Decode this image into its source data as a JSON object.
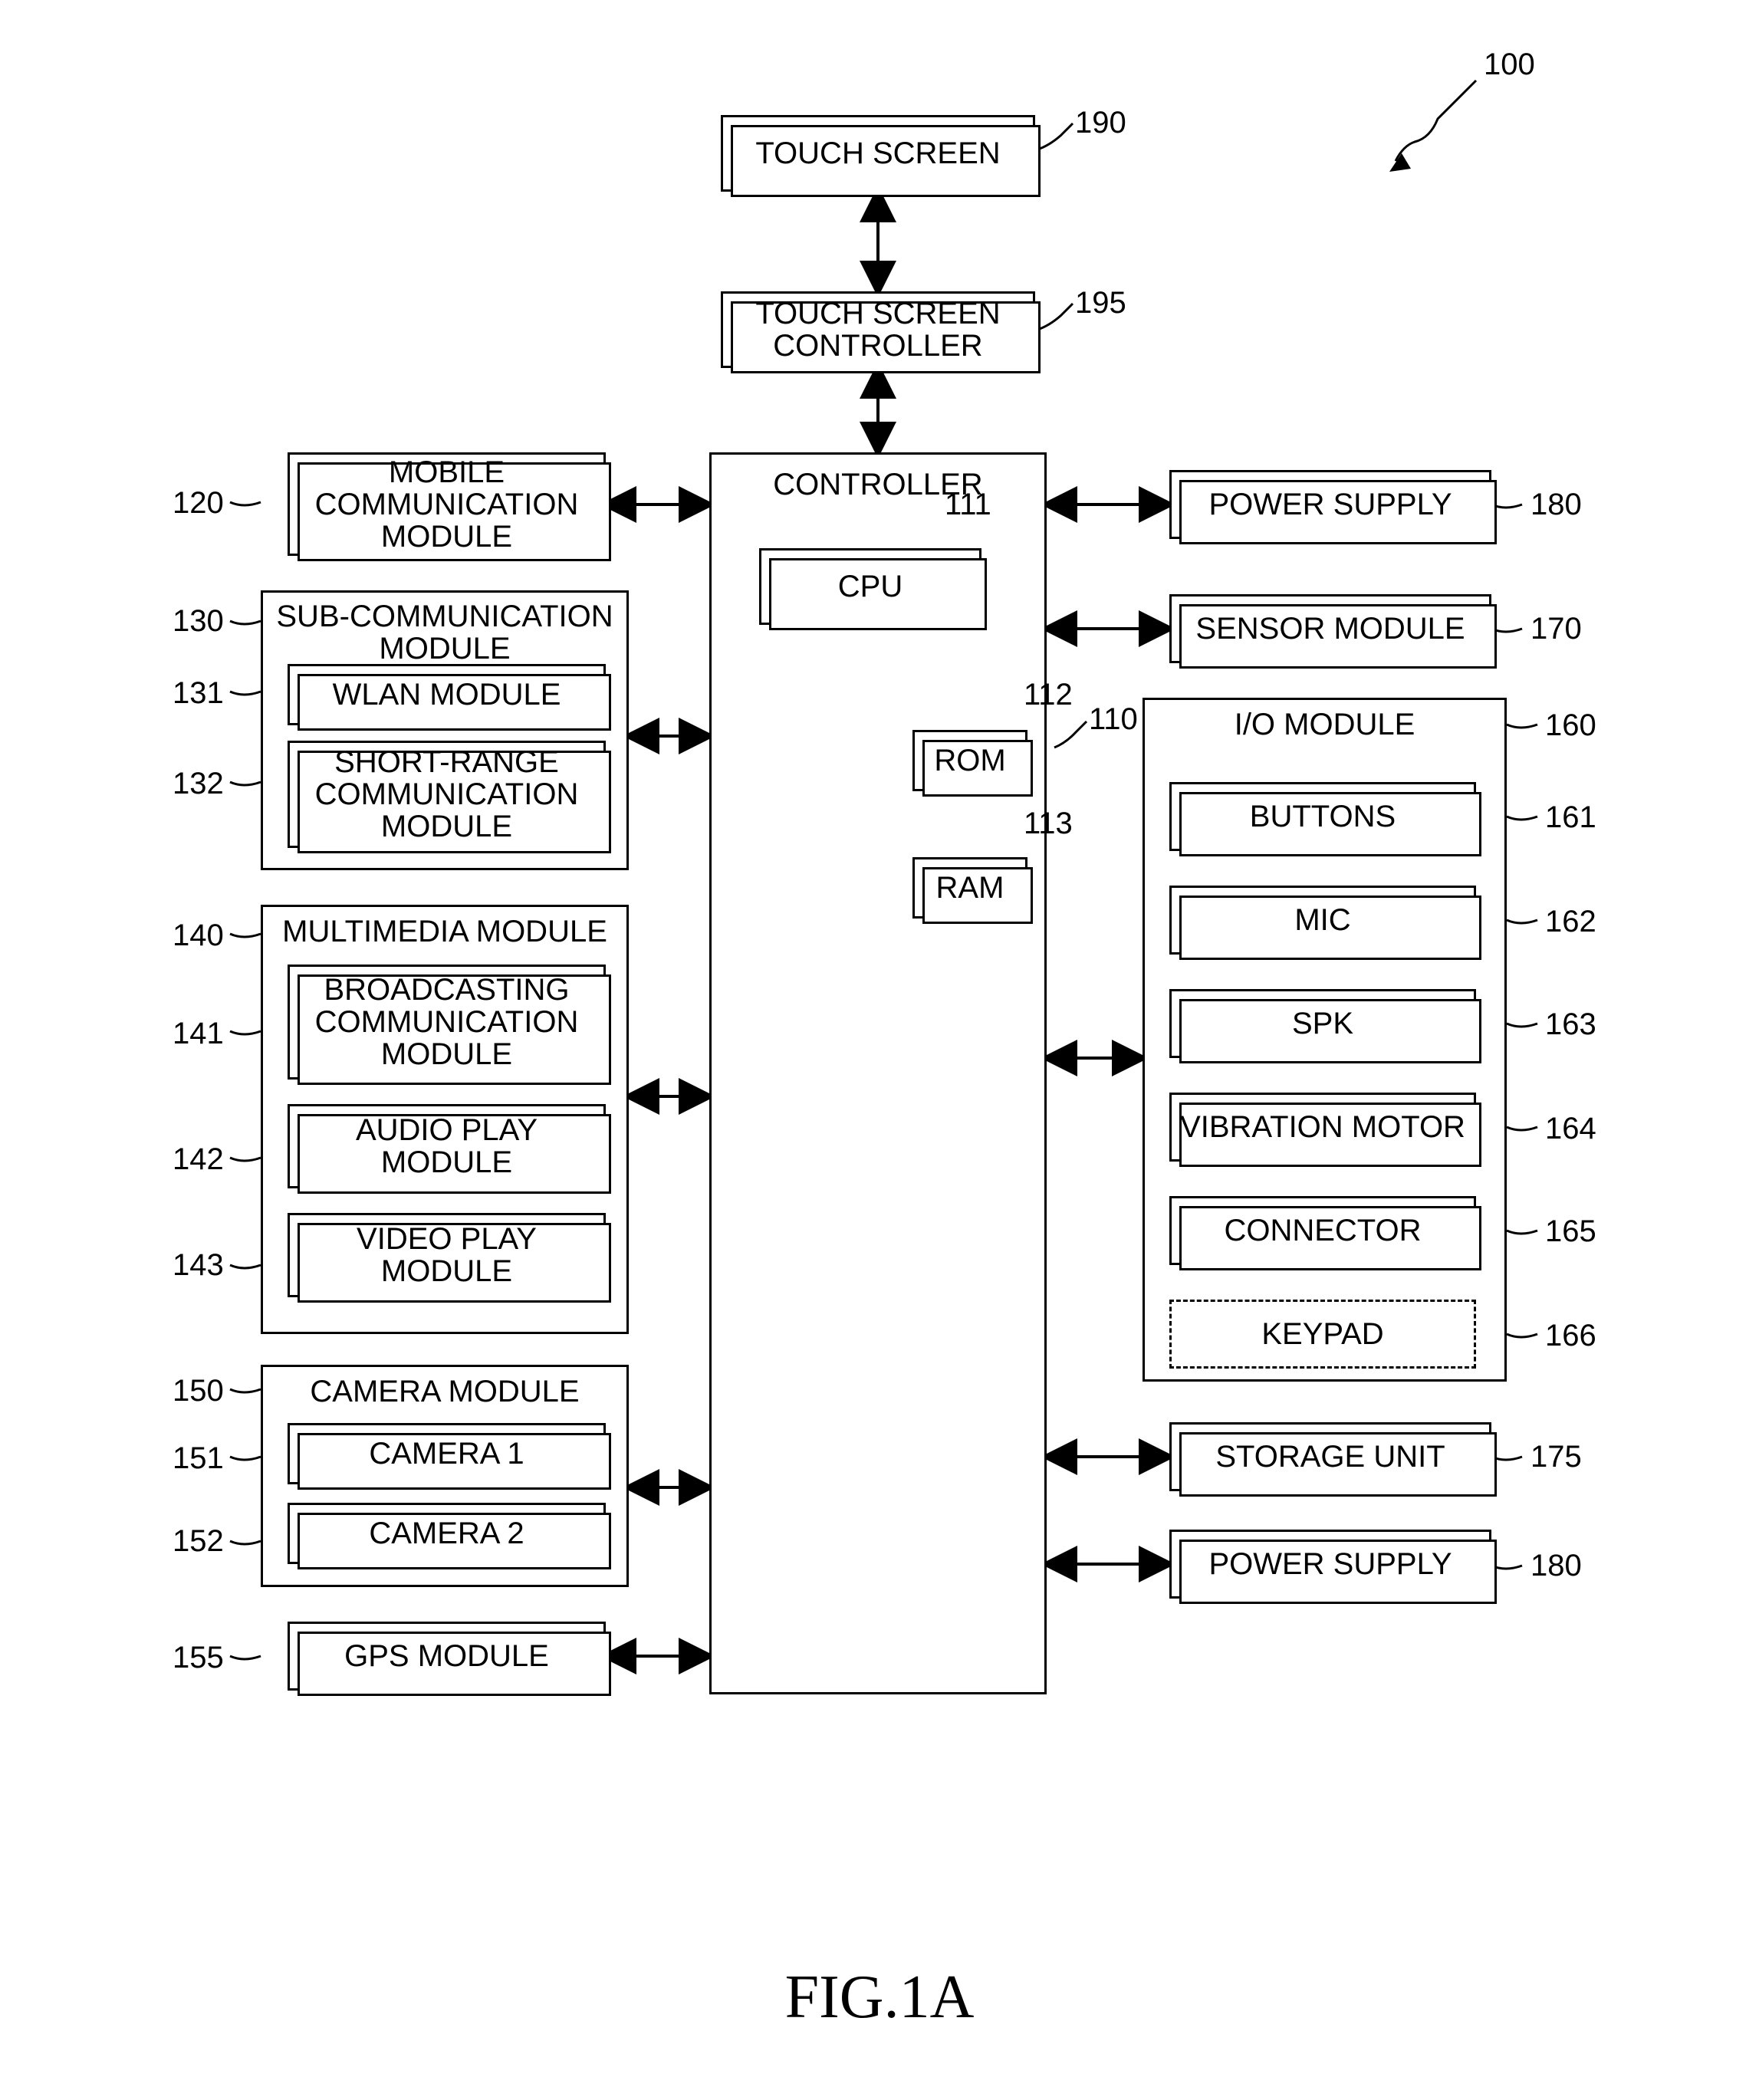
{
  "figure": {
    "caption": "FIG.1A",
    "overall_ref": "100"
  },
  "top": {
    "touch_screen": {
      "label": "TOUCH SCREEN",
      "ref": "190"
    },
    "touch_screen_controller": {
      "label": "TOUCH SCREEN CONTROLLER",
      "ref": "195"
    }
  },
  "controller": {
    "label": "CONTROLLER",
    "ref": "110",
    "cpu": {
      "label": "CPU",
      "ref": "111"
    },
    "rom": {
      "label": "ROM",
      "ref": "112"
    },
    "ram": {
      "label": "RAM",
      "ref": "113"
    }
  },
  "left": {
    "mobile_comm": {
      "label": "MOBILE COMMUNICATION MODULE",
      "ref": "120"
    },
    "sub_comm": {
      "label": "SUB-COMMUNICATION MODULE",
      "ref": "130",
      "wlan": {
        "label": "WLAN MODULE",
        "ref": "131"
      },
      "short_range": {
        "label": "SHORT-RANGE COMMUNICATION MODULE",
        "ref": "132"
      }
    },
    "multimedia": {
      "label": "MULTIMEDIA MODULE",
      "ref": "140",
      "broadcast": {
        "label": "BROADCASTING COMMUNICATION MODULE",
        "ref": "141"
      },
      "audio": {
        "label": "AUDIO PLAY MODULE",
        "ref": "142"
      },
      "video": {
        "label": "VIDEO PLAY MODULE",
        "ref": "143"
      }
    },
    "camera": {
      "label": "CAMERA MODULE",
      "ref": "150",
      "cam1": {
        "label": "CAMERA 1",
        "ref": "151"
      },
      "cam2": {
        "label": "CAMERA 2",
        "ref": "152"
      }
    },
    "gps": {
      "label": "GPS MODULE",
      "ref": "155"
    }
  },
  "right": {
    "power_supply_top": {
      "label": "POWER SUPPLY",
      "ref": "180"
    },
    "sensor": {
      "label": "SENSOR MODULE",
      "ref": "170"
    },
    "io": {
      "label": "I/O MODULE",
      "ref": "160",
      "buttons": {
        "label": "BUTTONS",
        "ref": "161"
      },
      "mic": {
        "label": "MIC",
        "ref": "162"
      },
      "spk": {
        "label": "SPK",
        "ref": "163"
      },
      "vibration": {
        "label": "VIBRATION MOTOR",
        "ref": "164"
      },
      "connector": {
        "label": "CONNECTOR",
        "ref": "165"
      },
      "keypad": {
        "label": "KEYPAD",
        "ref": "166"
      }
    },
    "storage": {
      "label": "STORAGE UNIT",
      "ref": "175"
    },
    "power_supply_bottom": {
      "label": "POWER SUPPLY",
      "ref": "180"
    }
  }
}
